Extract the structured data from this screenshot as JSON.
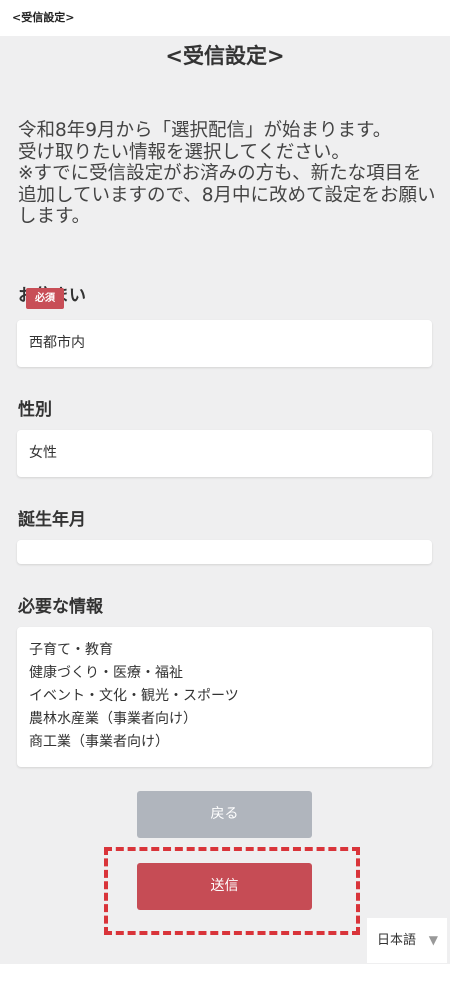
{
  "header": {
    "title": "<受信設定>"
  },
  "main": {
    "title": "<受信設定>",
    "intro": [
      "令和8年9月から「選択配信」が始まります。",
      "受け取りたい情報を選択してください。",
      "※すでに受信設定がお済みの方も、新たな項目を追加していますので、8月中に改めて設定をお願いします。"
    ]
  },
  "form": {
    "residence": {
      "label": "お住まい",
      "badge": "必須",
      "value": "西都市内"
    },
    "gender": {
      "label": "性別",
      "value": "女性"
    },
    "birth": {
      "label": "誕生年月",
      "value": ""
    },
    "info": {
      "label": "必要な情報",
      "items": [
        "子育て・教育",
        "健康づくり・医療・福祉",
        "イベント・文化・観光・スポーツ",
        "農林水産業（事業者向け）",
        "商工業（事業者向け）"
      ]
    }
  },
  "buttons": {
    "back": "戻る",
    "send": "送信"
  },
  "language": {
    "value": "日本語"
  },
  "colors": {
    "background": "#efeff0",
    "accent_red": "#c64c55",
    "back_gray": "#b0b5bd",
    "highlight": "#d9343a"
  }
}
